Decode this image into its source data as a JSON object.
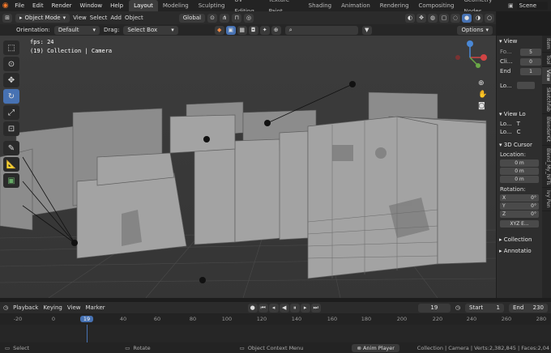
{
  "top_menu": [
    "File",
    "Edit",
    "Render",
    "Window",
    "Help"
  ],
  "workspaces": [
    "Layout",
    "Modeling",
    "Sculpting",
    "UV Editing",
    "Texture Paint",
    "Shading",
    "Animation",
    "Rendering",
    "Compositing",
    "Geometry Nodes"
  ],
  "active_workspace": "Layout",
  "scene_label": "Scene",
  "header": {
    "mode": "Object Mode",
    "view": "View",
    "select": "Select",
    "add": "Add",
    "object": "Object",
    "transform": "Global"
  },
  "subheader": {
    "orientation_label": "Orientation:",
    "orientation_value": "Default",
    "drag_label": "Drag:",
    "drag_value": "Select Box",
    "options": "Options"
  },
  "viewport": {
    "fps": "fps: 24",
    "collection": "(19) Collection | Camera"
  },
  "npanel": {
    "view_section": "View",
    "focal_label": "Fo...",
    "focal_value": "5",
    "clip_start_label": "Cli...",
    "clip_start_value": "0",
    "clip_end_label": "End",
    "clip_end_value": "1",
    "local_label": "Lo...",
    "view_lock": "View Lo",
    "lock1": "Lo...",
    "lock1_val": "T",
    "lock2": "Lo...",
    "lock2_val": "C",
    "cursor_section": "3D Cursor",
    "location_label": "Location:",
    "loc": [
      "0 m",
      "0 m",
      "0 m"
    ],
    "rotation_label": "Rotation:",
    "rot": [
      {
        "axis": "X",
        "val": "0°"
      },
      {
        "axis": "Y",
        "val": "0°"
      },
      {
        "axis": "Z",
        "val": "0°"
      }
    ],
    "rot_mode": "XYZ E...",
    "collection": "Collection",
    "annotations": "Annotatio"
  },
  "ntabs": [
    "Item",
    "Tool",
    "View",
    "Sketchfab",
    "BlenderKit",
    "Blend_My_NFTs",
    "Ivy Pen"
  ],
  "timeline": {
    "playback": "Playback",
    "keying": "Keying",
    "view": "View",
    "marker": "Marker",
    "current": "19",
    "start_label": "Start",
    "start": "1",
    "end_label": "End",
    "end": "230"
  },
  "ruler": [
    "-20",
    "0",
    "19",
    "40",
    "60",
    "80",
    "100",
    "120",
    "140",
    "160",
    "180",
    "200",
    "220",
    "240",
    "260",
    "280"
  ],
  "status": {
    "select": "Select",
    "rotate": "Rotate",
    "context": "Object Context Menu",
    "anim": "Anim Player",
    "stats": "Collection | Camera | Verts:2,382,845 | Faces:2,04"
  },
  "colors": {
    "accent": "#4772b3",
    "playhead": "#4772b3"
  }
}
